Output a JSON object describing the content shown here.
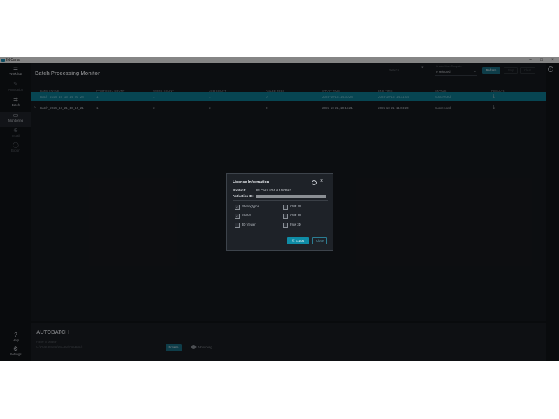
{
  "window": {
    "title": "IN Carta"
  },
  "sidebar": {
    "items": [
      {
        "label": "Workflow",
        "icon": "menu-icon",
        "glyph": "☰"
      },
      {
        "label": "Annotation",
        "icon": "annotation-icon",
        "glyph": "✎"
      },
      {
        "label": "Batch",
        "icon": "batch-icon",
        "glyph": "⇉"
      },
      {
        "label": "Monitoring",
        "icon": "monitor-icon",
        "glyph": "▭"
      },
      {
        "label": "Install",
        "icon": "install-icon",
        "glyph": "⊕"
      },
      {
        "label": "Export",
        "icon": "export-icon",
        "glyph": "◯"
      }
    ],
    "help": {
      "label": "Help",
      "glyph": "?"
    },
    "settings": {
      "label": "Settings",
      "glyph": "⚙"
    }
  },
  "main": {
    "title": "Batch Processing Monitor",
    "search_placeholder": "Search",
    "filter": {
      "label": "Created from Computer",
      "value": "0 selected"
    },
    "buttons": {
      "refresh": "Refresh",
      "stop": "Stop",
      "clear": "Clear"
    },
    "columns": [
      "BATCH NAME",
      "PROTOCOL COUNT",
      "WORK COUNT",
      "JOB COUNT",
      "FAILED JOBS",
      "START TIME",
      "END TIME",
      "STATUS",
      "RESULTS"
    ],
    "rows": [
      {
        "marker": "",
        "name": "Batch_2025_10_15_14_30_28",
        "protocol": "1",
        "work": "1",
        "job": "1",
        "failed": "0",
        "start": "2025-10-15, 14:30:28",
        "end": "2025-10-15, 14:31:04",
        "status": "Succeeded"
      },
      {
        "marker": "›",
        "name": "Batch_2025_10_21_10_15_21",
        "protocol": "1",
        "work": "3",
        "job": "3",
        "failed": "0",
        "start": "2025-10-21, 10:15:21",
        "end": "2025-10-21, 11:04:23",
        "status": "Succeeded"
      }
    ]
  },
  "autobatch": {
    "title": "AUTOBATCH",
    "path_label": "Folder to Monitor",
    "path": "C:\\ProgramData\\INCarta\\AutoBatch",
    "browse": "Browse",
    "monitoring": "Monitoring"
  },
  "dialog": {
    "title": "License Information",
    "product_label": "Product:",
    "product_value": "IN Carta v2.6.0.1082563",
    "activation_label": "Activation ID:",
    "options": [
      {
        "label": "Phenoglyphs",
        "checked": true
      },
      {
        "label": "CME 2D",
        "checked": false
      },
      {
        "label": "SINAP",
        "checked": true
      },
      {
        "label": "CME 3D",
        "checked": false
      },
      {
        "label": "3D Viewer",
        "checked": false
      },
      {
        "label": "Flow 3D",
        "checked": false
      }
    ],
    "export": "Export",
    "close": "Close"
  },
  "colors": {
    "accent": "#0f8ca6",
    "selected_row": "#0e7e96",
    "background": "#121418"
  }
}
